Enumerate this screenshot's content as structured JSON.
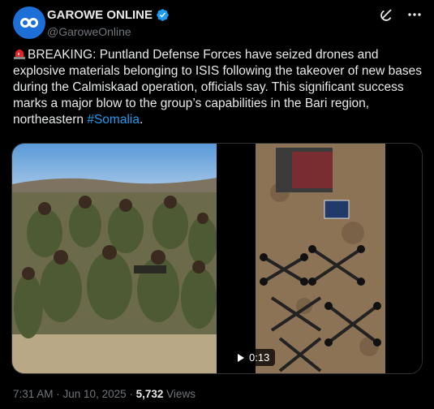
{
  "author": {
    "display_name": "GAROWE ONLINE",
    "handle": "@GaroweOnline",
    "avatar_icon": "garowe-logo-icon",
    "verified_icon": "verified-badge-icon",
    "verified_color": "#1d9bf0"
  },
  "header_actions": {
    "grok_icon": "grok-icon",
    "more_icon": "more-dots-icon"
  },
  "tweet": {
    "prefix_icon": "police-siren-emoji",
    "text_main": "BREAKING: Puntland Defense Forces have seized drones and explosive materials belonging to ISIS following the takeover of new bases during the Calmiskaad operation, officials say. This significant success marks a major blow to the group’s capabilities in the Bari region, northeastern ",
    "hashtag": "#Somalia",
    "text_end": "."
  },
  "media": {
    "left_image": "soldiers-group-photo",
    "right_video": "seized-drones-video",
    "video_duration": "0:13"
  },
  "meta": {
    "time": "7:31 AM",
    "separator": " · ",
    "date": "Jun 10, 2025",
    "views_count": "5,732",
    "views_label": "Views"
  },
  "colors": {
    "background": "#000000",
    "text": "#e7e9ea",
    "secondary": "#71767b",
    "accent": "#1d9bf0"
  }
}
